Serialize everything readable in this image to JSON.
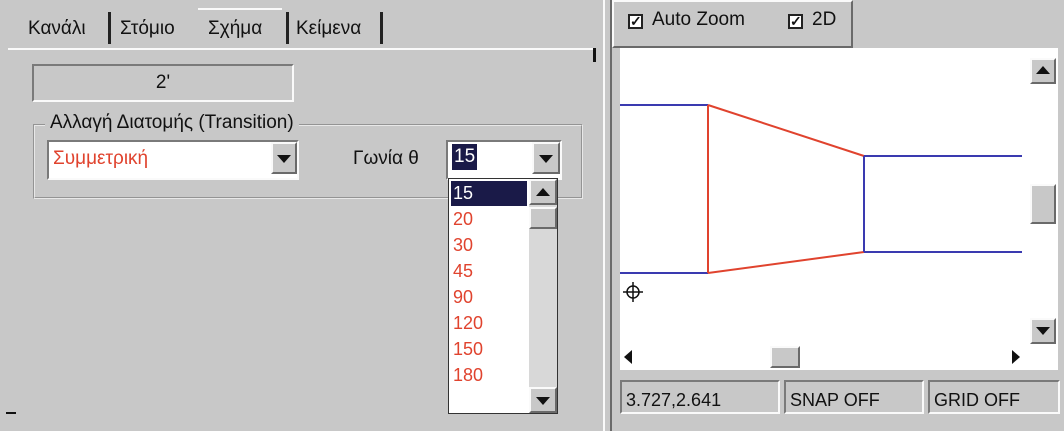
{
  "tabs": [
    {
      "label": "Κανάλι"
    },
    {
      "label": "Στόμιο"
    },
    {
      "label": "Σχήμα"
    },
    {
      "label": "Κείμενα"
    }
  ],
  "size_value": "2'",
  "transition_group": {
    "label": "Αλλαγή Διατομής (Transition)",
    "type_value": "Συμμετρική",
    "angle_label": "Γωνία θ",
    "angle_value": "15"
  },
  "angle_options": [
    "15",
    "20",
    "30",
    "45",
    "90",
    "120",
    "150",
    "180"
  ],
  "selected_angle": "15",
  "view_toolbar": {
    "auto_zoom_label": "Auto Zoom",
    "auto_zoom_checked": true,
    "two_d_label": "2D",
    "two_d_checked": true
  },
  "status_bar": {
    "coordinates": "3.727,2.641",
    "snap": "SNAP OFF",
    "grid": "GRID OFF"
  },
  "colors": {
    "option_text": "#e0432e",
    "selection_bg": "#1a1a48",
    "duct_outline": "#3a3ab0",
    "transition_outline": "#e0432e"
  },
  "icons": {
    "check": "checkmark-icon",
    "cursor": "crosshair-cursor-icon"
  }
}
